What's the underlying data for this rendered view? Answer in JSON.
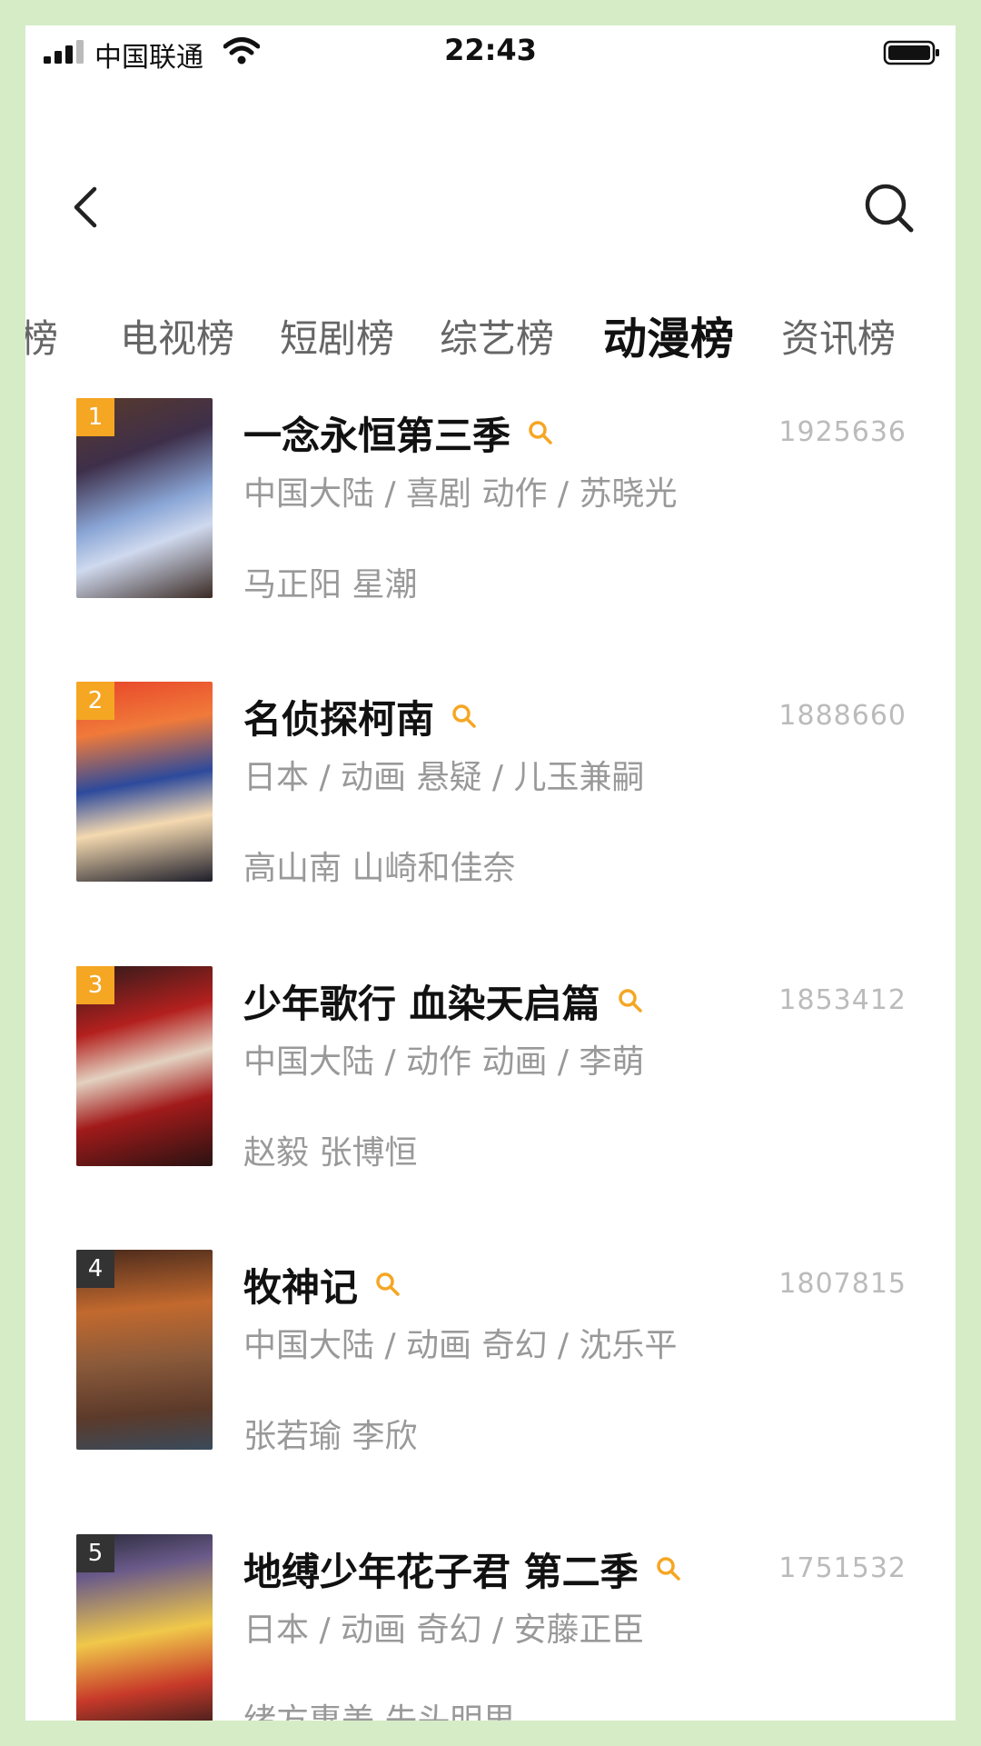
{
  "status_bar": {
    "carrier": "中国联通",
    "time": "22:43"
  },
  "nav": {
    "back_icon": "chevron-left-icon",
    "search_icon": "search-icon"
  },
  "tabs": [
    {
      "label": "榜"
    },
    {
      "label": "电视榜"
    },
    {
      "label": "短剧榜"
    },
    {
      "label": "综艺榜"
    },
    {
      "label": "动漫榜"
    },
    {
      "label": "资讯榜"
    }
  ],
  "active_tab": "动漫榜",
  "colors": {
    "rank_accent": "#f5a623",
    "rank_dark": "#333333",
    "search_accent": "#f5a623",
    "frame": "#d6ecc7"
  },
  "list": [
    {
      "rank": "1",
      "title": "一念永恒第三季",
      "count": "1925636",
      "meta": "中国大陆 / 喜剧 动作 / 苏晓光",
      "cast": "马正阳 星潮"
    },
    {
      "rank": "2",
      "title": "名侦探柯南",
      "count": "1888660",
      "meta": "日本 / 动画 悬疑 / 儿玉兼嗣",
      "cast": "高山南 山崎和佳奈"
    },
    {
      "rank": "3",
      "title": "少年歌行 血染天启篇",
      "count": "1853412",
      "meta": "中国大陆 / 动作 动画 / 李萌",
      "cast": "赵毅 张博恒"
    },
    {
      "rank": "4",
      "title": "牧神记",
      "count": "1807815",
      "meta": "中国大陆 / 动画 奇幻 / 沈乐平",
      "cast": "张若瑜 李欣"
    },
    {
      "rank": "5",
      "title": "地缚少年花子君 第二季",
      "count": "1751532",
      "meta": "日本 / 动画 奇幻 / 安藤正臣",
      "cast": "绪方惠美 先头明里"
    }
  ]
}
